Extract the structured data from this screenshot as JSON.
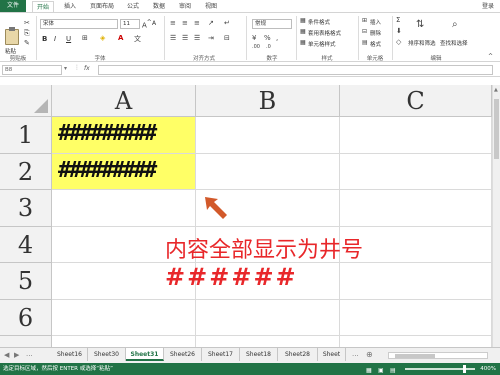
{
  "ribbon_tabs": [
    "文件",
    "开始",
    "插入",
    "页面布局",
    "公式",
    "数据",
    "审阅",
    "视图"
  ],
  "login": "登录",
  "clipboard": {
    "paste": "粘贴",
    "label": "剪贴板"
  },
  "font": {
    "name": "宋体",
    "size": "11",
    "label": "字体",
    "bold": "B",
    "italic": "I",
    "underline": "U"
  },
  "alignment": {
    "label": "对齐方式"
  },
  "number": {
    "format": "常规",
    "label": "数字"
  },
  "styles": {
    "conditional": "条件格式",
    "table": "套用表格格式",
    "cell": "单元格样式",
    "label": "样式"
  },
  "cells": {
    "insert": "插入",
    "delete": "删除",
    "format": "格式",
    "label": "单元格"
  },
  "editing": {
    "sort": "排序和筛选",
    "find": "查找和选择",
    "label": "编辑"
  },
  "formula_bar": {
    "name_box": "B8",
    "fx": "fx"
  },
  "grid": {
    "columns": [
      "A",
      "B",
      "C"
    ],
    "rows": [
      "1",
      "2",
      "3",
      "4",
      "5",
      "6"
    ],
    "cells": {
      "A1": "#########",
      "A2": "#########"
    }
  },
  "annotation": {
    "line1": "内容全部显示为井号",
    "line2": "######"
  },
  "sheet_tabs": [
    "Sheet16",
    "Sheet30",
    "Sheet31",
    "Sheet26",
    "Sheet17",
    "Sheet18",
    "Sheet28",
    "Sheet"
  ],
  "active_sheet": "Sheet31",
  "sheet_nav": {
    "prev": "◀",
    "next": "▶",
    "more": "..."
  },
  "status": {
    "message": "选定目标区域，然后按 ENTER 或选择“粘贴”",
    "zoom": "400%"
  },
  "colors": {
    "accent": "#217346",
    "highlight": "#ffff66",
    "annotation": "#e8272a",
    "arrow": "#d2592a"
  }
}
